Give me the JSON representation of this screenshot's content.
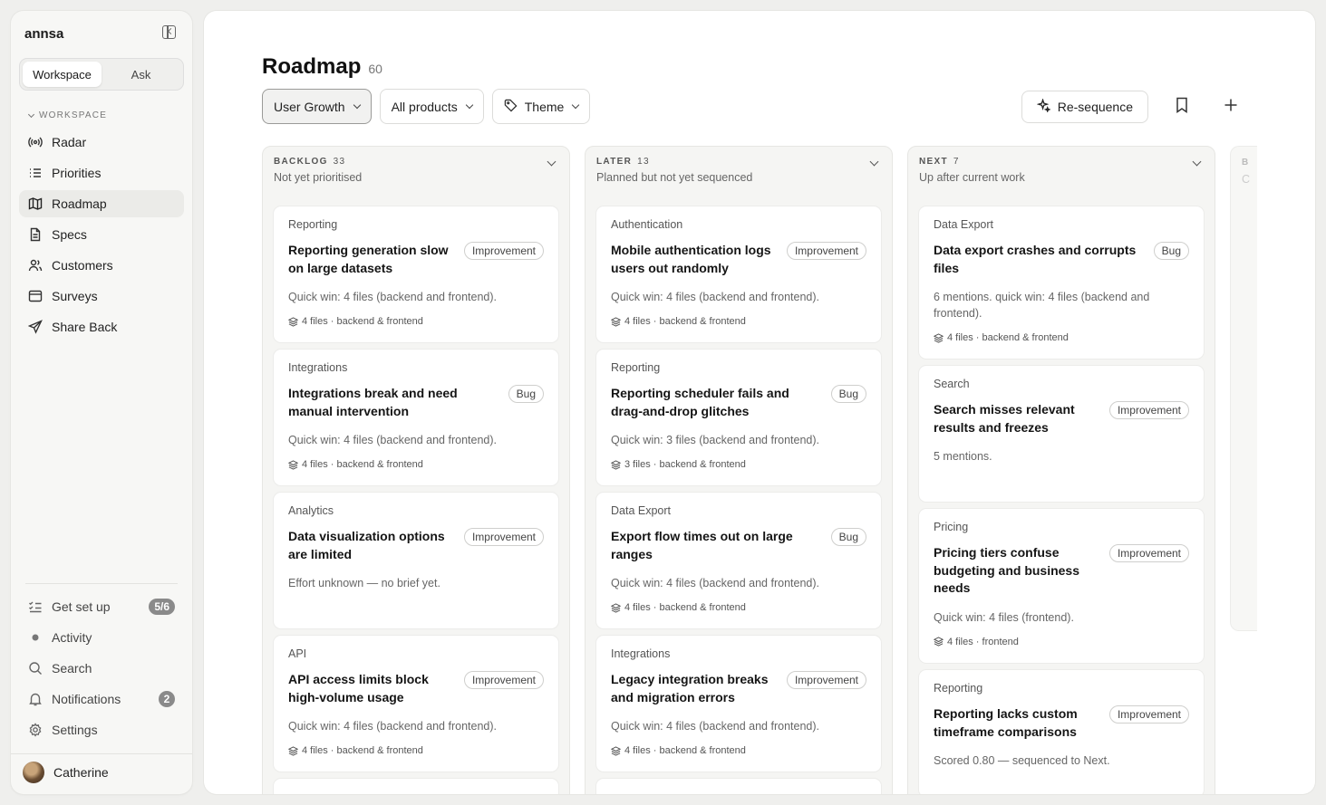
{
  "app": {
    "brand": "annsa",
    "segments": [
      "Workspace",
      "Ask"
    ],
    "section_label": "WORKSPACE"
  },
  "nav": [
    {
      "label": "Radar",
      "icon": "radar-icon"
    },
    {
      "label": "Priorities",
      "icon": "list-icon"
    },
    {
      "label": "Roadmap",
      "icon": "map-icon",
      "active": true
    },
    {
      "label": "Specs",
      "icon": "document-icon"
    },
    {
      "label": "Customers",
      "icon": "users-icon"
    },
    {
      "label": "Surveys",
      "icon": "browser-icon"
    },
    {
      "label": "Share Back",
      "icon": "send-icon"
    }
  ],
  "nav_bottom": [
    {
      "label": "Get set up",
      "icon": "checklist-icon",
      "badge": "5/6"
    },
    {
      "label": "Activity",
      "icon": "dot-icon"
    },
    {
      "label": "Search",
      "icon": "search-icon"
    },
    {
      "label": "Notifications",
      "icon": "bell-icon",
      "badge": "2"
    },
    {
      "label": "Settings",
      "icon": "gear-icon"
    }
  ],
  "user": {
    "name": "Catherine"
  },
  "page": {
    "title": "Roadmap",
    "count": "60",
    "filters": [
      "User Growth",
      "All products",
      "Theme"
    ],
    "resequence_label": "Re-sequence"
  },
  "columns": [
    {
      "title": "BACKLOG",
      "count": "33",
      "subtitle": "Not yet prioritised",
      "cards": [
        {
          "category": "Reporting",
          "title": "Reporting generation slow on large datasets",
          "tag": "Improvement",
          "desc": "Quick win: 4 files (backend and frontend).",
          "meta": "4 files · backend & frontend"
        },
        {
          "category": "Integrations",
          "title": "Integrations break and need manual intervention",
          "tag": "Bug",
          "desc": "Quick win: 4 files (backend and frontend).",
          "meta": "4 files · backend & frontend"
        },
        {
          "category": "Analytics",
          "title": "Data visualization options are limited",
          "tag": "Improvement",
          "desc": "Effort unknown — no brief yet.",
          "meta": ""
        },
        {
          "category": "API",
          "title": "API access limits block high-volume usage",
          "tag": "Improvement",
          "desc": "Quick win: 4 files (backend and frontend).",
          "meta": "4 files · backend & frontend"
        }
      ]
    },
    {
      "title": "LATER",
      "count": "13",
      "subtitle": "Planned but not yet sequenced",
      "cards": [
        {
          "category": "Authentication",
          "title": "Mobile authentication logs users out randomly",
          "tag": "Improvement",
          "desc": "Quick win: 4 files (backend and frontend).",
          "meta": "4 files · backend & frontend"
        },
        {
          "category": "Reporting",
          "title": "Reporting scheduler fails and drag-and-drop glitches",
          "tag": "Bug",
          "desc": "Quick win: 3 files (backend and frontend).",
          "meta": "3 files · backend & frontend"
        },
        {
          "category": "Data Export",
          "title": "Export flow times out on large ranges",
          "tag": "Bug",
          "desc": "Quick win: 4 files (backend and frontend).",
          "meta": "4 files · backend & frontend"
        },
        {
          "category": "Integrations",
          "title": "Legacy integration breaks and migration errors",
          "tag": "Improvement",
          "desc": "Quick win: 4 files (backend and frontend).",
          "meta": "4 files · backend & frontend"
        }
      ]
    },
    {
      "title": "NEXT",
      "count": "7",
      "subtitle": "Up after current work",
      "cards": [
        {
          "category": "Data Export",
          "title": "Data export crashes and corrupts files",
          "tag": "Bug",
          "desc": "6 mentions. quick win: 4 files (backend and frontend).",
          "meta": "4 files · backend & frontend"
        },
        {
          "category": "Search",
          "title": "Search misses relevant results and freezes",
          "tag": "Improvement",
          "desc": "5 mentions.",
          "meta": ""
        },
        {
          "category": "Pricing",
          "title": "Pricing tiers confuse budgeting and business needs",
          "tag": "Improvement",
          "desc": "Quick win: 4 files (frontend).",
          "meta": "4 files · frontend"
        },
        {
          "category": "Reporting",
          "title": "Reporting lacks custom timeframe comparisons",
          "tag": "Improvement",
          "desc": "Scored 0.80 — sequenced to Next.",
          "meta": ""
        }
      ]
    }
  ]
}
